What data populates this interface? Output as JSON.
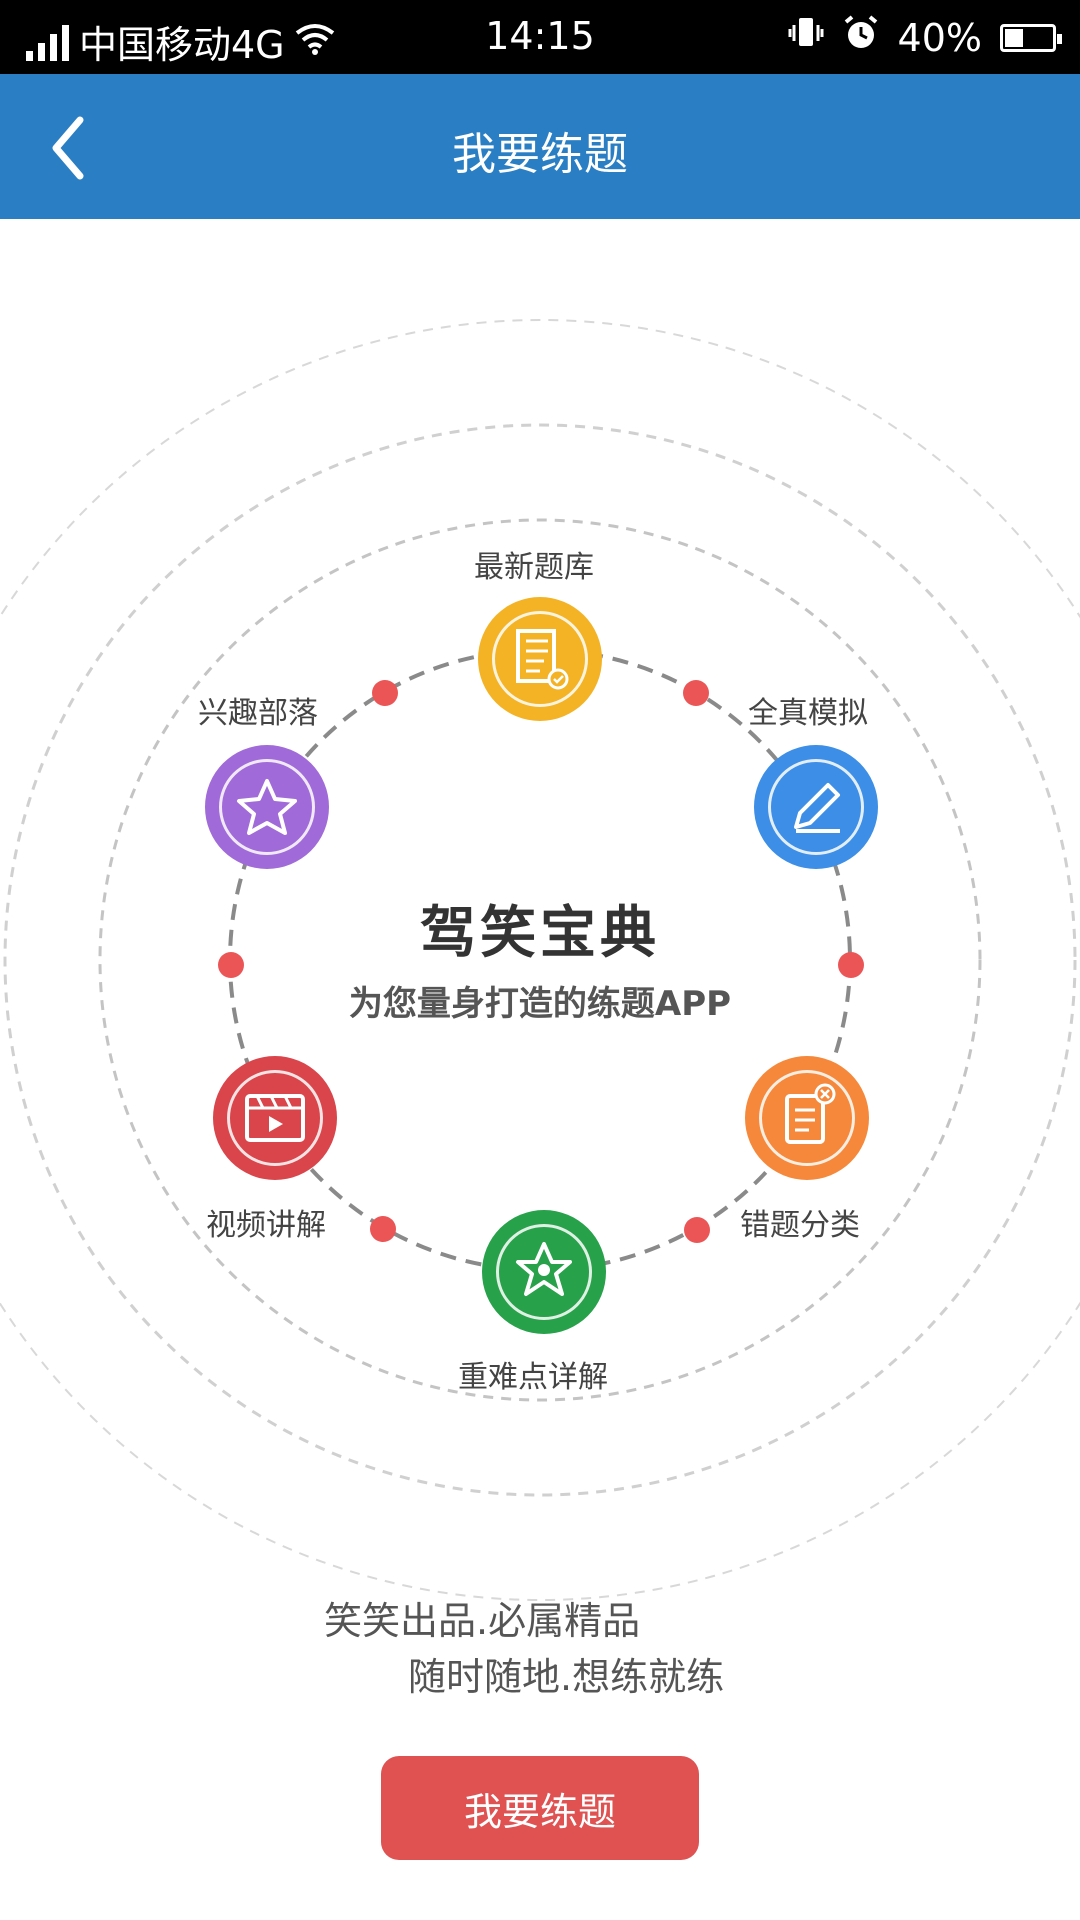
{
  "status_bar": {
    "carrier": "中国移动4G",
    "time": "14:15",
    "battery": "40%",
    "battery_level": 0.4,
    "icons": [
      "signal-icon",
      "wifi-icon",
      "vibrate-icon",
      "alarm-icon",
      "battery-icon"
    ]
  },
  "header": {
    "title": "我要练题",
    "back_icon": "chevron-left-icon",
    "color": "#2a7fc4"
  },
  "center": {
    "title": "驾笑宝典",
    "subtitle": "为您量身打造的练题APP"
  },
  "features": [
    {
      "label": "最新题库",
      "icon": "question-bank-icon",
      "color": "#f3b324"
    },
    {
      "label": "全真模拟",
      "icon": "pencil-icon",
      "color": "#3c8ee6"
    },
    {
      "label": "错题分类",
      "icon": "wrong-note-icon",
      "color": "#f5883a"
    },
    {
      "label": "重难点详解",
      "icon": "gear-star-icon",
      "color": "#27a14a"
    },
    {
      "label": "视频讲解",
      "icon": "video-icon",
      "color": "#d9454a"
    },
    {
      "label": "兴趣部落",
      "icon": "star-icon",
      "color": "#a06ad9"
    }
  ],
  "slogan": {
    "line1": "笑笑出品.必属精品",
    "line2": "随时随地.想练就练"
  },
  "cta": {
    "label": "我要练题",
    "color": "#e05252"
  }
}
